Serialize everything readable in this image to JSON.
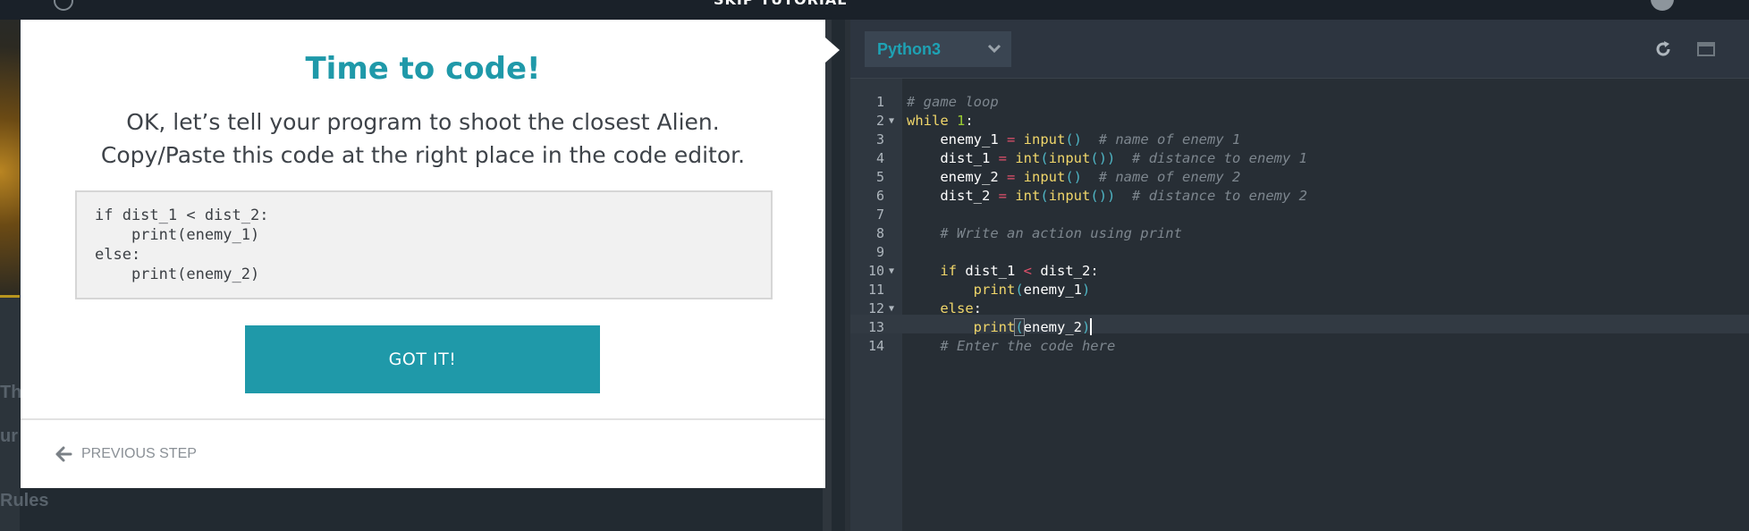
{
  "topbar": {
    "title": "SKIP TUTORIAL"
  },
  "background": {
    "left_label_1": "Th",
    "left_label_2": "ur",
    "left_label_3": "Rules"
  },
  "popup": {
    "title": "Time to code!",
    "line1": "OK, let’s tell your program to shoot the closest Alien.",
    "line2": "Copy/Paste this code at the right place in the code editor.",
    "code_snippet": "if dist_1 < dist_2:\n    print(enemy_1)\nelse:\n    print(enemy_2)",
    "button_label": "GOT IT!",
    "previous_label": "PREVIOUS STEP"
  },
  "editor": {
    "language": "Python3",
    "line_numbers": [
      "1",
      "2",
      "3",
      "4",
      "5",
      "6",
      "7",
      "8",
      "9",
      "10",
      "11",
      "12",
      "13",
      "14"
    ]
  },
  "colors": {
    "accent": "#1f99a9",
    "editor_bg": "#272e35",
    "keyword": "#f0d66a",
    "operator": "#e0506b",
    "comment": "#7d868e"
  }
}
